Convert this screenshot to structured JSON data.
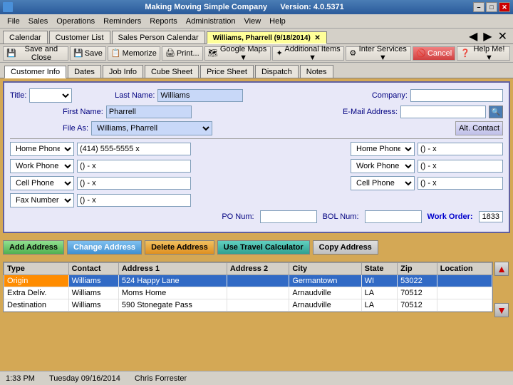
{
  "window": {
    "title": "Making Moving Simple Company",
    "version": "Version: 4.0.5371",
    "icon": "app-icon"
  },
  "title_bar": {
    "minimize_label": "–",
    "maximize_label": "□",
    "close_label": "✕"
  },
  "menu": {
    "items": [
      "File",
      "Sales",
      "Operations",
      "Reminders",
      "Reports",
      "Administration",
      "View",
      "Help"
    ]
  },
  "main_tabs": [
    {
      "id": "calendar",
      "label": "Calendar"
    },
    {
      "id": "customer-list",
      "label": "Customer List"
    },
    {
      "id": "sales-person",
      "label": "Sales Person Calendar"
    },
    {
      "id": "williams",
      "label": "Williams, Pharrell (9/18/2014)",
      "active": true
    }
  ],
  "toolbar": {
    "buttons": [
      {
        "id": "save-close",
        "icon": "💾",
        "label": "Save and Close"
      },
      {
        "id": "save",
        "icon": "💾",
        "label": "Save"
      },
      {
        "id": "memorize",
        "icon": "📋",
        "label": "Memorize"
      },
      {
        "id": "print",
        "icon": "🖨",
        "label": "Print..."
      },
      {
        "id": "google-maps",
        "icon": "🗺",
        "label": "Google Maps ▼"
      },
      {
        "id": "additional-items",
        "icon": "✦",
        "label": "Additional Items ▼"
      },
      {
        "id": "inter-services",
        "icon": "⚙",
        "label": "Inter Services ▼"
      },
      {
        "id": "cancel",
        "icon": "🚫",
        "label": "Cancel"
      },
      {
        "id": "help",
        "icon": "❓",
        "label": "Help Me! ▼"
      }
    ]
  },
  "customer_tabs": [
    {
      "id": "customer-info",
      "label": "Customer Info",
      "active": true
    },
    {
      "id": "dates",
      "label": "Dates"
    },
    {
      "id": "job-info",
      "label": "Job Info"
    },
    {
      "id": "cube-sheet",
      "label": "Cube Sheet"
    },
    {
      "id": "price-sheet",
      "label": "Price Sheet"
    },
    {
      "id": "dispatch",
      "label": "Dispatch"
    },
    {
      "id": "notes",
      "label": "Notes"
    }
  ],
  "form": {
    "title_label": "Title:",
    "title_value": "",
    "last_name_label": "Last Name:",
    "last_name_value": "Williams",
    "company_label": "Company:",
    "company_value": "",
    "first_name_label": "First Name:",
    "first_name_value": "Pharrell",
    "email_label": "E-Mail Address:",
    "email_value": "",
    "file_as_label": "File As:",
    "file_as_value": "Williams, Pharrell",
    "alt_contact_label": "Alt. Contact",
    "phone_rows": [
      {
        "type1": "Home Phone",
        "val1": "(414) 555-5555 x",
        "type2": "Home Phone",
        "val2": "() - x"
      },
      {
        "type1": "Work Phone",
        "val1": "() - x",
        "type2": "Work Phone",
        "val2": "() - x"
      },
      {
        "type1": "Cell Phone",
        "val1": "() - x",
        "type2": "Cell Phone",
        "val2": "() - x"
      },
      {
        "type1": "Fax Number",
        "val1": "() - x",
        "type2": "",
        "val2": ""
      }
    ],
    "po_num_label": "PO Num:",
    "po_num_value": "",
    "bol_num_label": "BOL Num:",
    "bol_num_value": "",
    "work_order_label": "Work Order:",
    "work_order_value": "1833"
  },
  "address_buttons": [
    {
      "id": "add-address",
      "label": "Add Address",
      "style": "green"
    },
    {
      "id": "change-address",
      "label": "Change Address",
      "style": "blue"
    },
    {
      "id": "delete-address",
      "label": "Delete Address",
      "style": "orange"
    },
    {
      "id": "travel-calculator",
      "label": "Use Travel Calculator",
      "style": "teal"
    },
    {
      "id": "copy-address",
      "label": "Copy Address",
      "style": "gray"
    }
  ],
  "address_table": {
    "headers": [
      "Type",
      "Contact",
      "Address 1",
      "Address 2",
      "City",
      "State",
      "Zip",
      "Location"
    ],
    "rows": [
      {
        "type": "Origin",
        "contact": "Williams",
        "address1": "524 Happy Lane",
        "address2": "",
        "city": "Germantown",
        "state": "WI",
        "zip": "53022",
        "location": "",
        "selected": true
      },
      {
        "type": "Extra Deliv.",
        "contact": "Williams",
        "address1": "Moms Home",
        "address2": "",
        "city": "Arnaudville",
        "state": "LA",
        "zip": "70512",
        "location": ""
      },
      {
        "type": "Destination",
        "contact": "Williams",
        "address1": "590 Stonegate Pass",
        "address2": "",
        "city": "Arnaudville",
        "state": "LA",
        "zip": "70512",
        "location": ""
      }
    ]
  },
  "status_bar": {
    "time": "1:33 PM",
    "date": "Tuesday 09/16/2014",
    "user": "Chris Forrester"
  }
}
